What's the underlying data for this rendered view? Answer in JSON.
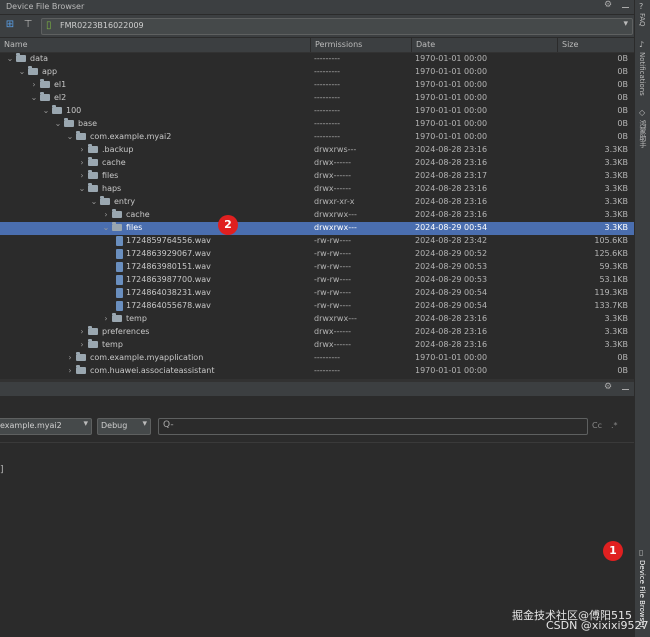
{
  "window": {
    "title": "Device File Browser"
  },
  "device": {
    "name": "FMR0223B16022009"
  },
  "columns": {
    "name": "Name",
    "permissions": "Permissions",
    "date": "Date",
    "size": "Size"
  },
  "rows": [
    {
      "name": "data",
      "perm": "---------",
      "date": "1970-01-01 00:00",
      "size": "0B",
      "depth": 0,
      "arrow": "down",
      "type": "folder"
    },
    {
      "name": "app",
      "perm": "---------",
      "date": "1970-01-01 00:00",
      "size": "0B",
      "depth": 1,
      "arrow": "down",
      "type": "folder"
    },
    {
      "name": "el1",
      "perm": "---------",
      "date": "1970-01-01 00:00",
      "size": "0B",
      "depth": 2,
      "arrow": "right",
      "type": "folder"
    },
    {
      "name": "el2",
      "perm": "---------",
      "date": "1970-01-01 00:00",
      "size": "0B",
      "depth": 2,
      "arrow": "down",
      "type": "folder"
    },
    {
      "name": "100",
      "perm": "---------",
      "date": "1970-01-01 00:00",
      "size": "0B",
      "depth": 3,
      "arrow": "down",
      "type": "folder"
    },
    {
      "name": "base",
      "perm": "---------",
      "date": "1970-01-01 00:00",
      "size": "0B",
      "depth": 4,
      "arrow": "down",
      "type": "folder"
    },
    {
      "name": "com.example.myai2",
      "perm": "---------",
      "date": "1970-01-01 00:00",
      "size": "0B",
      "depth": 5,
      "arrow": "down",
      "type": "folder"
    },
    {
      "name": ".backup",
      "perm": "drwxrws---",
      "date": "2024-08-28 23:16",
      "size": "3.3KB",
      "depth": 6,
      "arrow": "right",
      "type": "folder"
    },
    {
      "name": "cache",
      "perm": "drwx------",
      "date": "2024-08-28 23:16",
      "size": "3.3KB",
      "depth": 6,
      "arrow": "right",
      "type": "folder"
    },
    {
      "name": "files",
      "perm": "drwx------",
      "date": "2024-08-28 23:17",
      "size": "3.3KB",
      "depth": 6,
      "arrow": "right",
      "type": "folder"
    },
    {
      "name": "haps",
      "perm": "drwx------",
      "date": "2024-08-28 23:16",
      "size": "3.3KB",
      "depth": 6,
      "arrow": "down",
      "type": "folder"
    },
    {
      "name": "entry",
      "perm": "drwxr-xr-x",
      "date": "2024-08-28 23:16",
      "size": "3.3KB",
      "depth": 7,
      "arrow": "down",
      "type": "folder"
    },
    {
      "name": "cache",
      "perm": "drwxrwx---",
      "date": "2024-08-28 23:16",
      "size": "3.3KB",
      "depth": 8,
      "arrow": "right",
      "type": "folder"
    },
    {
      "name": "files",
      "perm": "drwxrwx---",
      "date": "2024-08-29 00:54",
      "size": "3.3KB",
      "depth": 8,
      "arrow": "down",
      "type": "folder",
      "selected": true
    },
    {
      "name": "1724859764556.wav",
      "perm": "-rw-rw----",
      "date": "2024-08-28 23:42",
      "size": "105.6KB",
      "depth": 9,
      "arrow": "",
      "type": "wav"
    },
    {
      "name": "1724863929067.wav",
      "perm": "-rw-rw----",
      "date": "2024-08-29 00:52",
      "size": "125.6KB",
      "depth": 9,
      "arrow": "",
      "type": "wav"
    },
    {
      "name": "1724863980151.wav",
      "perm": "-rw-rw----",
      "date": "2024-08-29 00:53",
      "size": "59.3KB",
      "depth": 9,
      "arrow": "",
      "type": "wav"
    },
    {
      "name": "1724863987700.wav",
      "perm": "-rw-rw----",
      "date": "2024-08-29 00:53",
      "size": "53.1KB",
      "depth": 9,
      "arrow": "",
      "type": "wav"
    },
    {
      "name": "1724864038231.wav",
      "perm": "-rw-rw----",
      "date": "2024-08-29 00:54",
      "size": "119.3KB",
      "depth": 9,
      "arrow": "",
      "type": "wav"
    },
    {
      "name": "1724864055678.wav",
      "perm": "-rw-rw----",
      "date": "2024-08-29 00:54",
      "size": "133.7KB",
      "depth": 9,
      "arrow": "",
      "type": "wav"
    },
    {
      "name": "temp",
      "perm": "drwxrwx---",
      "date": "2024-08-28 23:16",
      "size": "3.3KB",
      "depth": 8,
      "arrow": "right",
      "type": "folder"
    },
    {
      "name": "preferences",
      "perm": "drwx------",
      "date": "2024-08-28 23:16",
      "size": "3.3KB",
      "depth": 6,
      "arrow": "right",
      "type": "folder"
    },
    {
      "name": "temp",
      "perm": "drwx------",
      "date": "2024-08-28 23:16",
      "size": "3.3KB",
      "depth": 6,
      "arrow": "right",
      "type": "folder"
    },
    {
      "name": "com.example.myapplication",
      "perm": "---------",
      "date": "1970-01-01 00:00",
      "size": "0B",
      "depth": 5,
      "arrow": "right",
      "type": "folder"
    },
    {
      "name": "com.huawei.associateassistant",
      "perm": "---------",
      "date": "1970-01-01 00:00",
      "size": "0B",
      "depth": 5,
      "arrow": "right",
      "type": "folder"
    }
  ],
  "badges": {
    "one": "1",
    "two": "2"
  },
  "log": {
    "process": "example.myai2",
    "level": "Debug",
    "search_placeholder": "Q-",
    "cc": "Cc",
    "regex": ".*",
    "bracket": "]"
  },
  "rightbar": {
    "faq": "FAQ",
    "notifications": "Notifications",
    "chinese": "鸿蒙助手",
    "dfb": "Device File Browser"
  },
  "watermark": {
    "line1": "掘金技术社区@傅阳515",
    "line2": "CSDN @xixixi9527"
  },
  "icons": {
    "collapse": "collapse-icon",
    "tree": "tree-icon",
    "phone": "phone-icon",
    "gear": "gear-icon",
    "folder": "folder-icon",
    "wav": "wav-file-icon"
  }
}
